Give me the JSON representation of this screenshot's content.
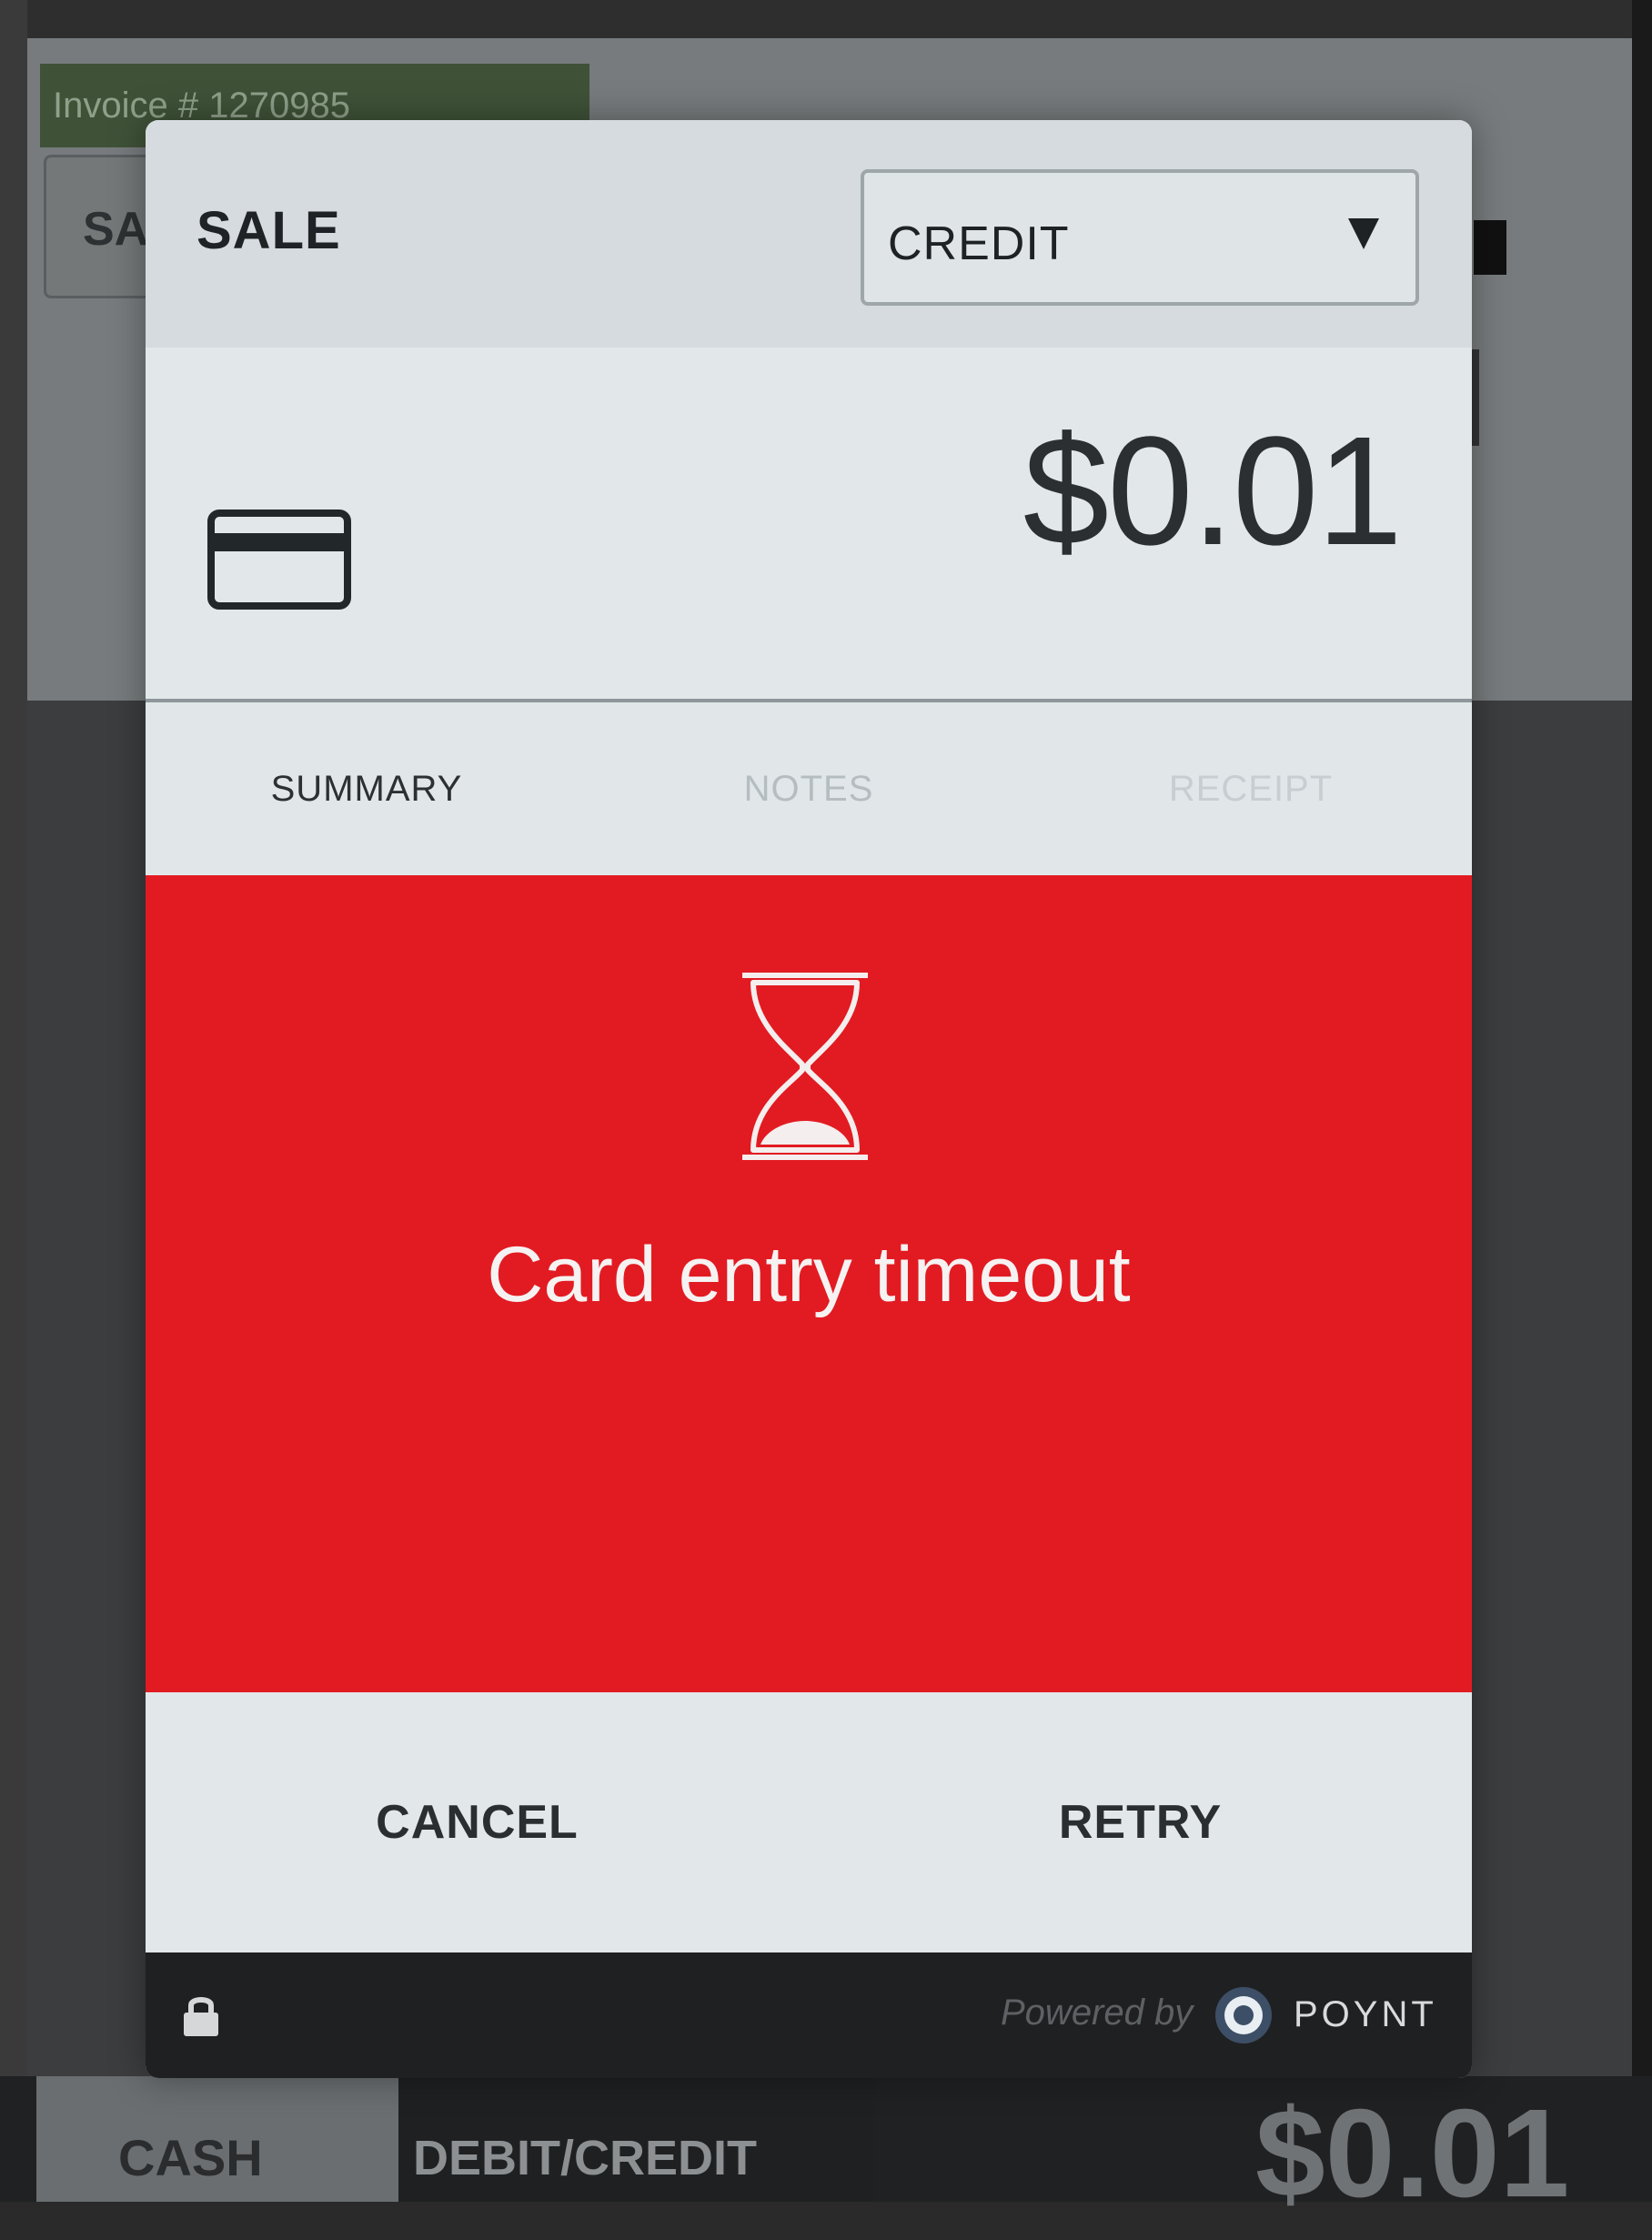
{
  "background": {
    "invoice_label": "Invoice # 1270985",
    "sale_button_label": "SA",
    "bottom_tabs": [
      "CASH",
      "DEBIT/CREDIT"
    ],
    "total": "$0.01"
  },
  "dialog": {
    "title": "SALE",
    "payment_type": {
      "selected": "CREDIT"
    },
    "amount": "$0.01",
    "card_icon": "credit-card-icon",
    "tabs": [
      {
        "label": "SUMMARY",
        "active": true
      },
      {
        "label": "NOTES",
        "active": false
      },
      {
        "label": "RECEIPT",
        "active": false
      }
    ],
    "status": {
      "icon": "hourglass-icon",
      "message": "Card entry timeout",
      "color": "#e21b22"
    },
    "actions": {
      "cancel": "CANCEL",
      "retry": "RETRY"
    },
    "footer": {
      "lock_icon": "lock-icon",
      "powered_by": "Powered by",
      "brand": "POYNT"
    }
  }
}
